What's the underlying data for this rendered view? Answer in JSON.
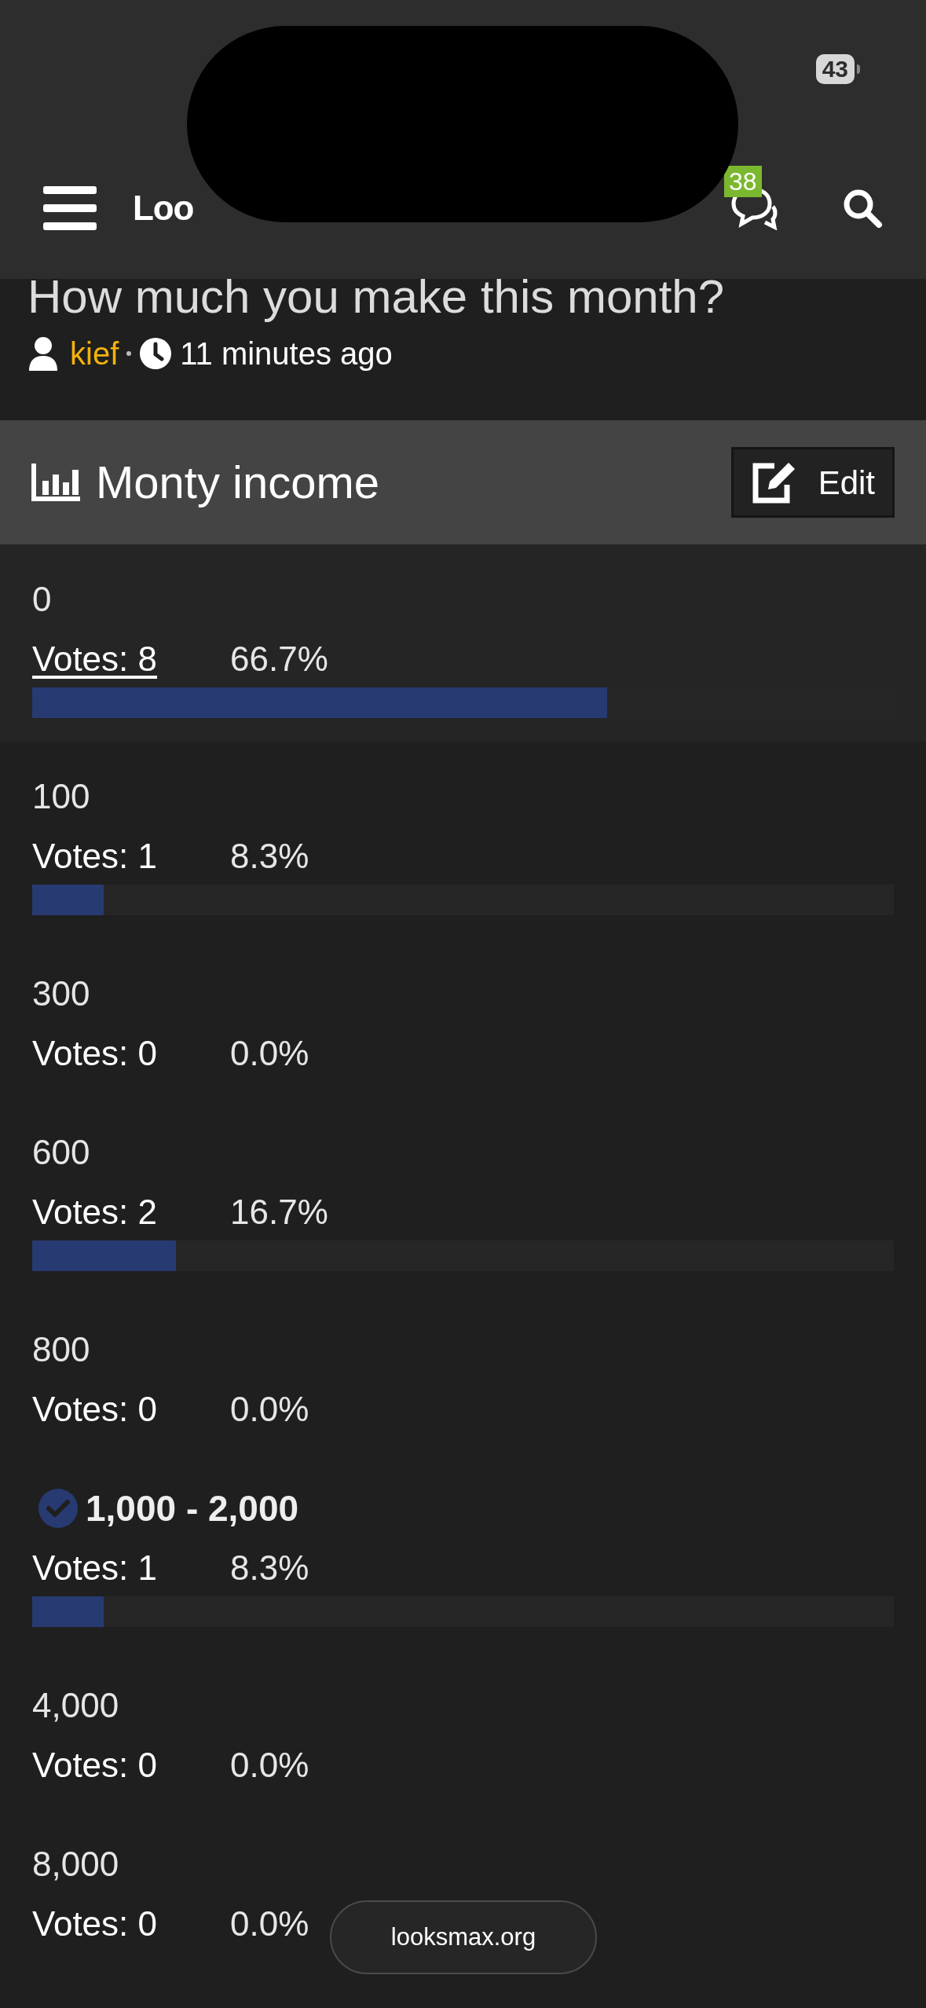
{
  "status_bar": {
    "battery": "43"
  },
  "nav": {
    "logo": "Loo",
    "chat_badge": "38"
  },
  "thread": {
    "title": "How much you make this month?",
    "author": "kief",
    "time": "11 minutes ago"
  },
  "poll": {
    "title": "Monty income",
    "edit_button": "Edit",
    "options": [
      {
        "label": "0",
        "votes": "Votes: 8",
        "percent": "66.7%",
        "level": 0.667,
        "selected": false,
        "hovered": true
      },
      {
        "label": "100",
        "votes": "Votes: 1",
        "percent": "8.3%",
        "level": 0.083,
        "selected": false,
        "hovered": false
      },
      {
        "label": "300",
        "votes": "Votes: 0",
        "percent": "0.0%",
        "selected": false,
        "hovered": false
      },
      {
        "label": "600",
        "votes": "Votes: 2",
        "percent": "16.7%",
        "level": 0.167,
        "selected": false,
        "hovered": false
      },
      {
        "label": "800",
        "votes": "Votes: 0",
        "percent": "0.0%",
        "selected": false,
        "hovered": false
      },
      {
        "label": "1,000 - 2,000",
        "votes": "Votes: 1",
        "percent": "8.3%",
        "level": 0.083,
        "selected": true,
        "hovered": false
      },
      {
        "label": "4,000",
        "votes": "Votes: 0",
        "percent": "0.0%",
        "selected": false,
        "hovered": false
      },
      {
        "label": "8,000",
        "votes": "Votes: 0",
        "percent": "0.0%",
        "selected": false,
        "hovered": false
      }
    ]
  },
  "url_pill": "looksmax.org"
}
